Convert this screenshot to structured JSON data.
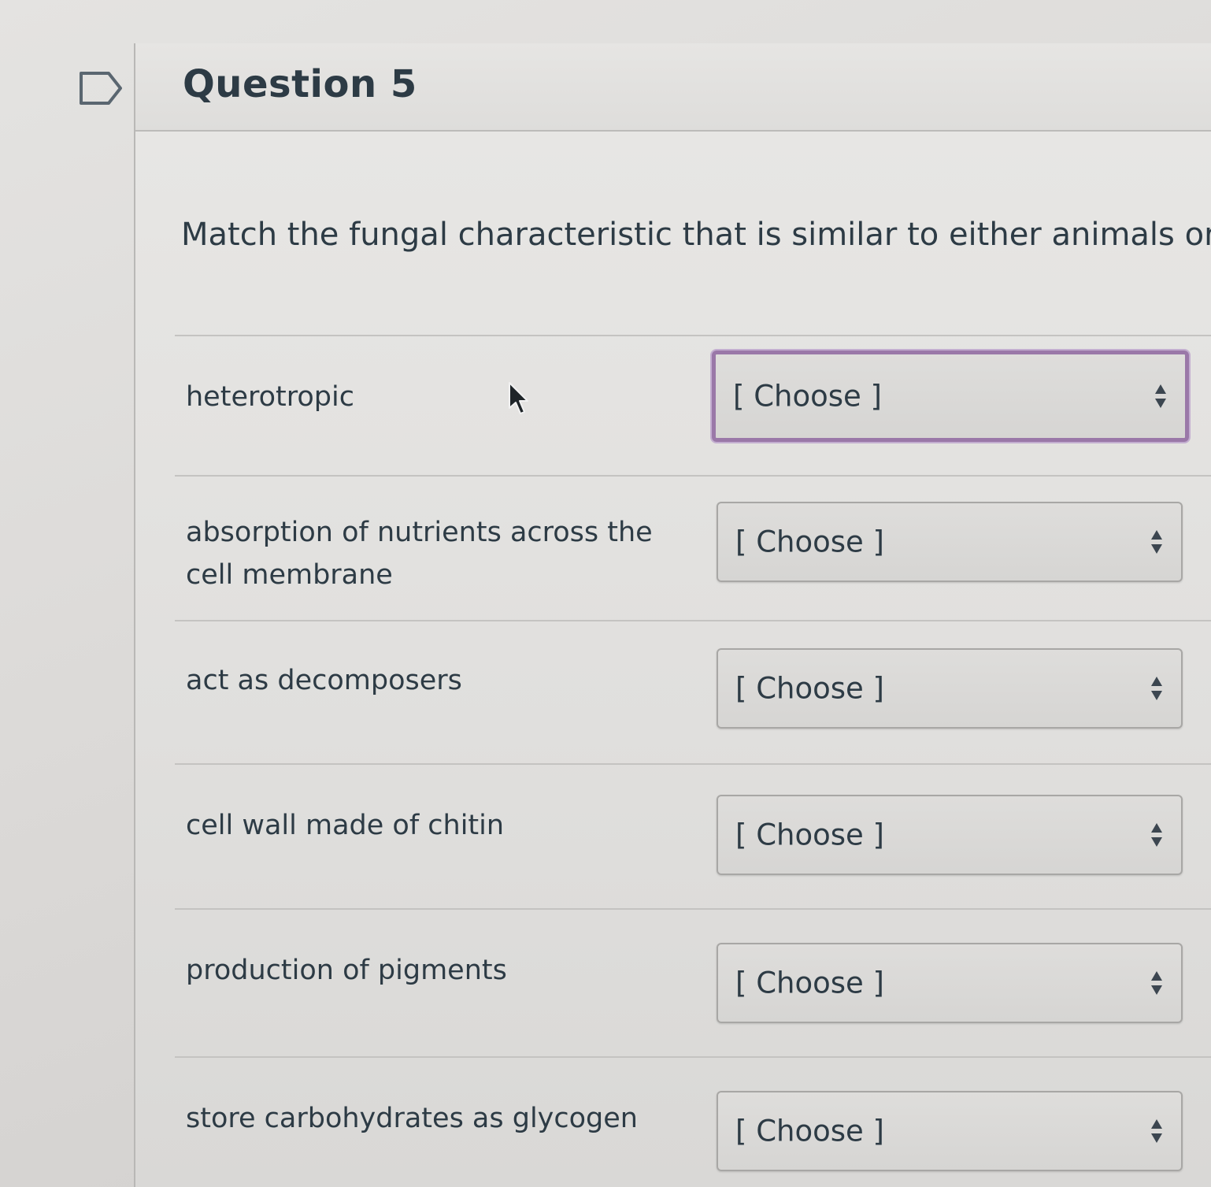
{
  "question": {
    "title": "Question 5",
    "prompt": "Match the fungal characteristic that is similar to either animals or bacte"
  },
  "rows": [
    {
      "label": "heterotropic",
      "selected": "[ Choose ]",
      "focused": true
    },
    {
      "label": "absorption of nutrients across the cell membrane",
      "selected": "[ Choose ]",
      "focused": false
    },
    {
      "label": "act as decomposers",
      "selected": "[ Choose ]",
      "focused": false
    },
    {
      "label": "cell wall made of chitin",
      "selected": "[ Choose ]",
      "focused": false
    },
    {
      "label": "production of pigments",
      "selected": "[ Choose ]",
      "focused": false
    },
    {
      "label": "store carbohydrates as glycogen",
      "selected": "[ Choose ]",
      "focused": false
    }
  ],
  "colors": {
    "focus_border": "#9a78a8",
    "text": "#2d3b45"
  },
  "icons": {
    "flag": "flag-icon",
    "select_arrows": "select-arrows-icon",
    "cursor": "mouse-pointer-icon"
  }
}
